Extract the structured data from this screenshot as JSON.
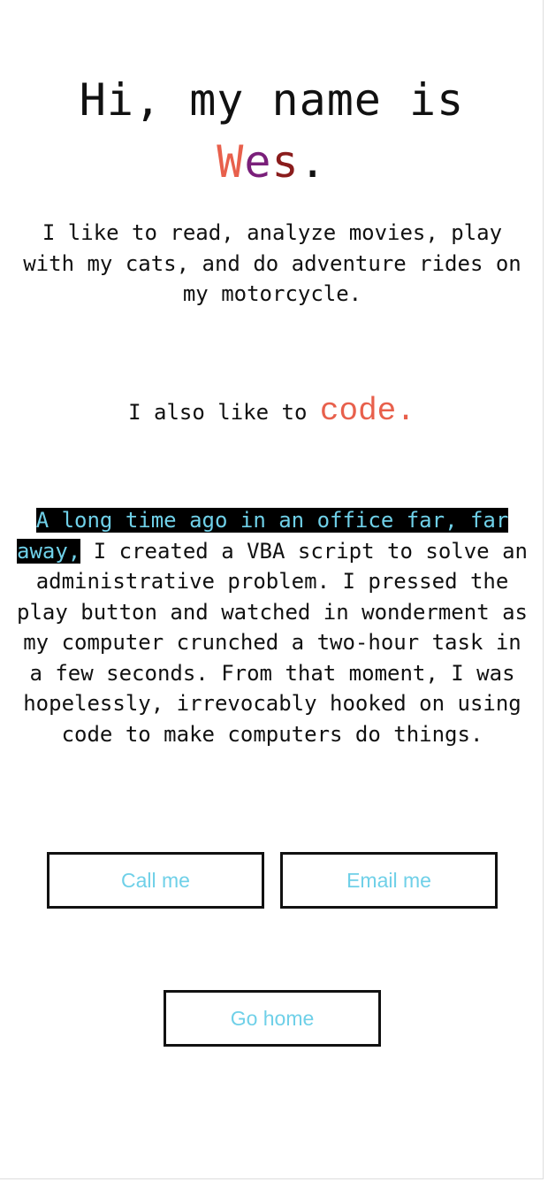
{
  "header": {
    "title_prefix": "Hi, my name is",
    "name_w": "W",
    "name_e": "e",
    "name_s": "s",
    "name_period": "."
  },
  "intro": {
    "text": "I like to read, analyze movies, play with my cats, and do adventure rides on my motorcycle."
  },
  "also": {
    "prefix": "I also like to",
    "highlight_word": "code."
  },
  "story": {
    "highlight": "A long time ago in an office far, far away,",
    "text": " I created a VBA script to solve an administrative problem. I pressed the play button and watched in wonderment as my computer crunched a two-hour task in a few seconds. From that moment, I was hopelessly, irrevocably hooked on using code to make computers do things."
  },
  "buttons": {
    "call": "Call me",
    "email": "Email me",
    "home": "Go home"
  },
  "colors": {
    "accent_orange": "#e8604c",
    "accent_purple": "#7a1f7a",
    "accent_maroon": "#8a1c1c",
    "link_cyan": "#6fd0e8"
  }
}
